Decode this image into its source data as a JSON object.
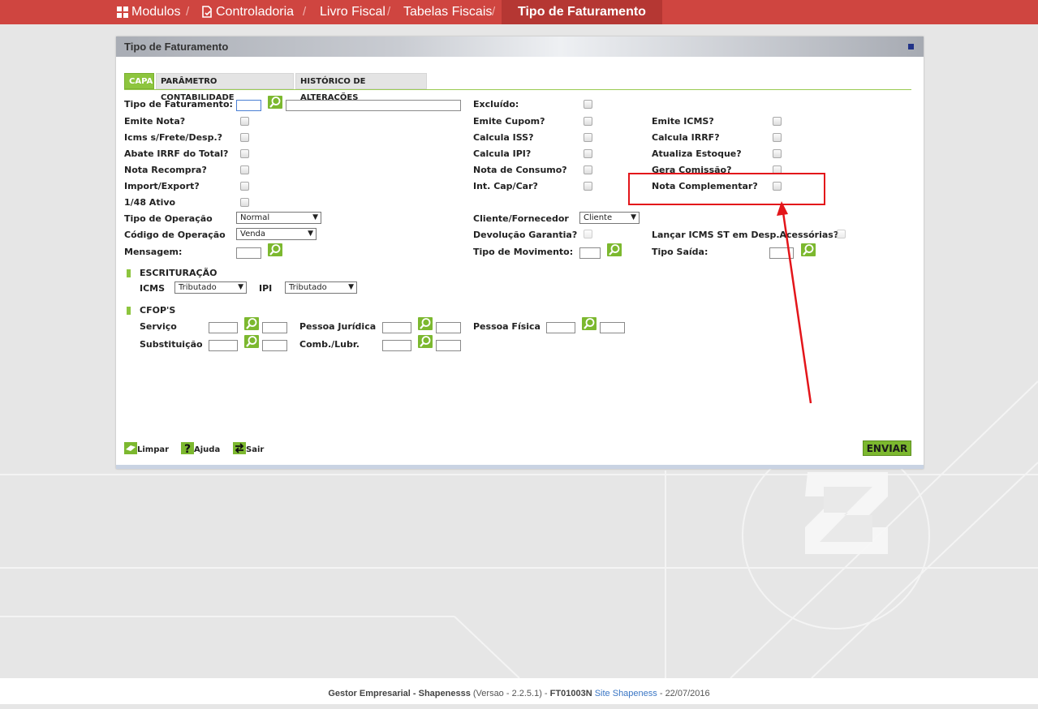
{
  "breadcrumb": {
    "items": [
      "Modulos",
      "Controladoria",
      "Livro Fiscal",
      "Tabelas Fiscais"
    ],
    "separator": "/",
    "active": "Tipo de Faturamento"
  },
  "panel": {
    "title": "Tipo de Faturamento",
    "tabs": [
      "CAPA",
      "PARÂMETRO CONTABILIDADE",
      "HISTÓRICO DE ALTERAÇÕES"
    ]
  },
  "fields": {
    "tipo_faturamento": "Tipo de Faturamento:",
    "emite_nota": "Emite Nota?",
    "icms_frete": "Icms s/Frete/Desp.?",
    "abate_irrf": "Abate IRRF do Total?",
    "nota_recompra": "Nota Recompra?",
    "import_export": "Import/Export?",
    "ativo_148": "1/48 Ativo",
    "tipo_operacao": "Tipo de Operação",
    "codigo_operacao": "Código de Operação",
    "mensagem": "Mensagem:",
    "excluido": "Excluído:",
    "emite_cupom": "Emite Cupom?",
    "calcula_iss": "Calcula ISS?",
    "calcula_ipi": "Calcula IPI?",
    "nota_consumo": "Nota de Consumo?",
    "int_cap_car": "Int. Cap/Car?",
    "cliente_fornecedor": "Cliente/Fornecedor",
    "devolucao_garantia": "Devolução Garantia?",
    "tipo_movimento": "Tipo de Movimento:",
    "emite_icms": "Emite ICMS?",
    "calcula_irrf": "Calcula IRRF?",
    "atualiza_estoque": "Atualiza Estoque?",
    "gera_comissao": "Gera Comissão?",
    "nota_complementar": "Nota Complementar?",
    "lancar_icms_st": "Lançar ICMS ST em Desp.Acessórias?",
    "tipo_saida": "Tipo Saída:"
  },
  "selects": {
    "tipo_operacao": "Normal",
    "codigo_operacao": "Venda",
    "cliente_fornecedor": "Cliente",
    "icms": "Tributado",
    "ipi": "Tributado"
  },
  "escrituracao": {
    "title": "ESCRITURAÇÃO",
    "icms_label": "ICMS",
    "ipi_label": "IPI"
  },
  "cfops": {
    "title": "CFOP'S",
    "servico": "Serviço",
    "substituicao": "Substituição",
    "pessoa_juridica": "Pessoa Jurídica",
    "comb_lubr": "Comb./Lubr.",
    "pessoa_fisica": "Pessoa Física"
  },
  "actions": {
    "limpar": "Limpar",
    "ajuda": "Ajuda",
    "sair": "Sair",
    "enviar": "ENVIAR"
  },
  "footer": {
    "product": "Gestor Empresarial - Shapenesss",
    "version": "(Versao - 2.2.5.1) -",
    "code": "FT01003N",
    "site": "Site Shapeness",
    "date": "- 22/07/2016"
  },
  "colors": {
    "topbar": "#cf4540",
    "active_crumb": "#b53733",
    "accent_green": "#8dc53e",
    "annotation": "#e3151a"
  }
}
